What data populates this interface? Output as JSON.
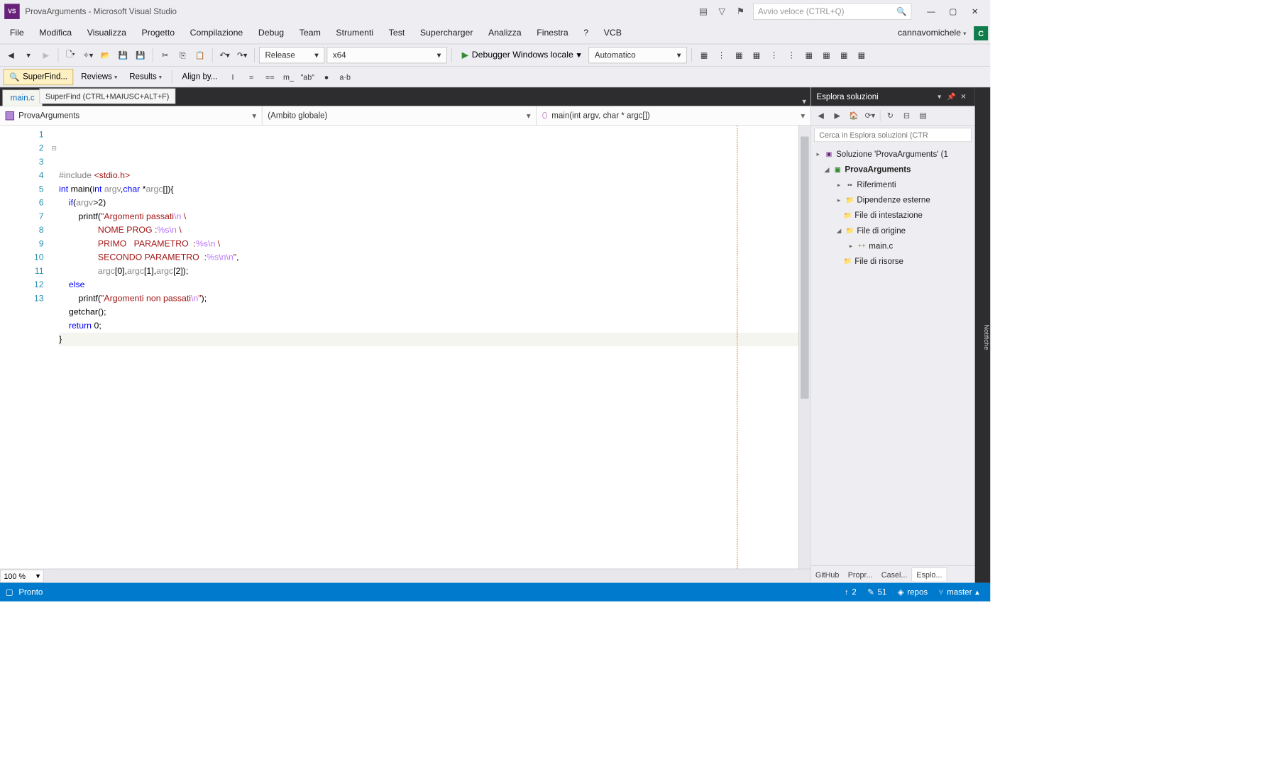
{
  "titlebar": {
    "title": "ProvaArguments - Microsoft Visual Studio",
    "quick_launch_placeholder": "Avvio veloce (CTRL+Q)"
  },
  "menu": {
    "items": [
      "File",
      "Modifica",
      "Visualizza",
      "Progetto",
      "Compilazione",
      "Debug",
      "Team",
      "Strumenti",
      "Test",
      "Supercharger",
      "Analizza",
      "Finestra",
      "?",
      "VCB"
    ],
    "user": "cannavomichele",
    "avatar": "C"
  },
  "toolbar": {
    "config": "Release",
    "platform": "x64",
    "debug_btn": "Debugger Windows locale",
    "auto": "Automatico"
  },
  "toolbar2": {
    "superfind": "SuperFind...",
    "reviews": "Reviews",
    "results": "Results",
    "alignby": "Align by..."
  },
  "doc_tabs": {
    "active": "main.c",
    "tooltip": "SuperFind (CTRL+MAIUSC+ALT+F)"
  },
  "nav_combos": {
    "project": "ProvaArguments",
    "scope": "(Ambito globale)",
    "func": "main(int argv, char * argc[])"
  },
  "code": {
    "lines": [
      {
        "n": 1,
        "seg": [
          {
            "t": "#include ",
            "c": "pp"
          },
          {
            "t": "<stdio.h>",
            "c": "str"
          }
        ]
      },
      {
        "n": 2,
        "fold": "⊟",
        "seg": [
          {
            "t": "int ",
            "c": "kw"
          },
          {
            "t": "main",
            "c": "fn"
          },
          {
            "t": "(",
            "c": ""
          },
          {
            "t": "int ",
            "c": "kw"
          },
          {
            "t": "argv",
            "c": "grey"
          },
          {
            "t": ",",
            "c": ""
          },
          {
            "t": "char ",
            "c": "kw"
          },
          {
            "t": "*",
            "c": ""
          },
          {
            "t": "argc",
            "c": "grey"
          },
          {
            "t": "[]){",
            "c": ""
          }
        ]
      },
      {
        "n": 3,
        "seg": [
          {
            "t": "    ",
            "c": ""
          },
          {
            "t": "if",
            "c": "kw"
          },
          {
            "t": "(",
            "c": ""
          },
          {
            "t": "argv",
            "c": "grey"
          },
          {
            "t": ">2)",
            "c": ""
          }
        ]
      },
      {
        "n": 4,
        "seg": [
          {
            "t": "        printf(",
            "c": ""
          },
          {
            "t": "\"Argomenti passati",
            "c": "str"
          },
          {
            "t": "\\n",
            "c": "esc"
          },
          {
            "t": " \\",
            "c": "str"
          }
        ]
      },
      {
        "n": 5,
        "seg": [
          {
            "t": "                NOME PROG :",
            "c": "str"
          },
          {
            "t": "%s",
            "c": "esc"
          },
          {
            "t": "\\n",
            "c": "esc"
          },
          {
            "t": " \\",
            "c": "str"
          }
        ]
      },
      {
        "n": 6,
        "seg": [
          {
            "t": "                PRIMO   PARAMETRO  :",
            "c": "str"
          },
          {
            "t": "%s",
            "c": "esc"
          },
          {
            "t": "\\n",
            "c": "esc"
          },
          {
            "t": " \\",
            "c": "str"
          }
        ]
      },
      {
        "n": 7,
        "seg": [
          {
            "t": "                SECONDO PARAMETRO  :",
            "c": "str"
          },
          {
            "t": "%s",
            "c": "esc"
          },
          {
            "t": "\\n\\n",
            "c": "esc"
          },
          {
            "t": "\"",
            "c": "str"
          },
          {
            "t": ",",
            "c": ""
          }
        ]
      },
      {
        "n": 8,
        "seg": [
          {
            "t": "                ",
            "c": ""
          },
          {
            "t": "argc",
            "c": "grey"
          },
          {
            "t": "[",
            "c": ""
          },
          {
            "t": "0",
            "c": "num"
          },
          {
            "t": "],",
            "c": ""
          },
          {
            "t": "argc",
            "c": "grey"
          },
          {
            "t": "[",
            "c": ""
          },
          {
            "t": "1",
            "c": "num"
          },
          {
            "t": "],",
            "c": ""
          },
          {
            "t": "argc",
            "c": "grey"
          },
          {
            "t": "[",
            "c": ""
          },
          {
            "t": "2",
            "c": "num"
          },
          {
            "t": "]);",
            "c": ""
          }
        ]
      },
      {
        "n": 9,
        "seg": [
          {
            "t": "    ",
            "c": ""
          },
          {
            "t": "else",
            "c": "kw"
          }
        ]
      },
      {
        "n": 10,
        "seg": [
          {
            "t": "        printf(",
            "c": ""
          },
          {
            "t": "\"Argomenti non passati",
            "c": "str"
          },
          {
            "t": "\\n",
            "c": "esc"
          },
          {
            "t": "\"",
            "c": "str"
          },
          {
            "t": ");",
            "c": ""
          }
        ]
      },
      {
        "n": 11,
        "seg": [
          {
            "t": "    getchar();",
            "c": ""
          }
        ]
      },
      {
        "n": 12,
        "seg": [
          {
            "t": "    ",
            "c": ""
          },
          {
            "t": "return ",
            "c": "kw"
          },
          {
            "t": "0;",
            "c": ""
          }
        ]
      },
      {
        "n": 13,
        "cursor": true,
        "marker": true,
        "seg": [
          {
            "t": "}",
            "c": "brace"
          }
        ]
      }
    ]
  },
  "zoom": "100 %",
  "solution_explorer": {
    "title": "Esplora soluzioni",
    "search_placeholder": "Cerca in Esplora soluzioni (CTR",
    "nodes": {
      "solution": "Soluzione 'ProvaArguments' (1",
      "project": "ProvaArguments",
      "refs": "Riferimenti",
      "ext": "Dipendenze esterne",
      "headers": "File di intestazione",
      "sources": "File di origine",
      "mainc": "main.c",
      "resources": "File di risorse"
    },
    "bottom_tabs": [
      "GitHub",
      "Propr...",
      "Casel...",
      "Esplo..."
    ]
  },
  "right_rail": [
    "Notifiche"
  ],
  "status": {
    "ready": "Pronto",
    "line_icon": "↑",
    "line": "2",
    "col_icon": "✎",
    "col": "51",
    "repo": "repos",
    "branch": "master"
  }
}
